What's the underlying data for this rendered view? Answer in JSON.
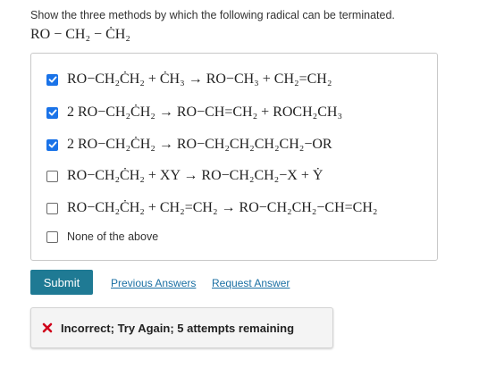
{
  "question": {
    "prompt": "Show the three methods by which the following radical can be terminated.",
    "radical": "RO − CH₂ − ĊH₂"
  },
  "options": [
    {
      "label": "RO−CH₂ĊH₂ + ĊH₃ → RO−CH₃ + CH₂=CH₂",
      "checked": true
    },
    {
      "label": "2 RO−CH₂ĊH₂ → RO−CH=CH₂ + ROCH₂CH₃",
      "checked": true
    },
    {
      "label": "2 RO−CH₂ĊH₂ → RO−CH₂CH₂CH₂CH₂−OR",
      "checked": true
    },
    {
      "label": "RO−CH₂ĊH₂ + XY → RO−CH₂CH₂−X + Ẏ",
      "checked": false
    },
    {
      "label": "RO−CH₂ĊH₂ + CH₂=CH₂ → RO−CH₂CH₂−CH=CH₂",
      "checked": false
    },
    {
      "label": "None of the above",
      "checked": false
    }
  ],
  "actions": {
    "submit_label": "Submit",
    "previous_answers_label": "Previous Answers",
    "request_answer_label": "Request Answer"
  },
  "feedback": {
    "message": "Incorrect; Try Again; 5 attempts remaining",
    "icon": "x-icon",
    "icon_color": "#d0021b"
  },
  "colors": {
    "checkbox_checked": "#1a73e8",
    "submit_button": "#1f7a94",
    "link": "#1a6fa3"
  }
}
